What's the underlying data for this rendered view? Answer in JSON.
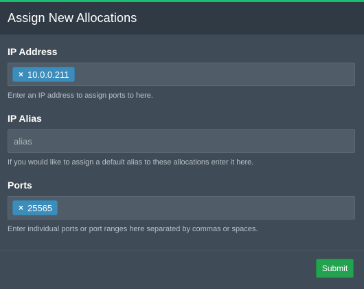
{
  "header": {
    "title": "Assign New Allocations"
  },
  "ip_address": {
    "label": "IP Address",
    "tag_remove": "×",
    "tag_value": "10.0.0.211",
    "help": "Enter an IP address to assign ports to here."
  },
  "ip_alias": {
    "label": "IP Alias",
    "placeholder": "alias",
    "value": "",
    "help": "If you would like to assign a default alias to these allocations enter it here."
  },
  "ports": {
    "label": "Ports",
    "tag_remove": "×",
    "tag_value": "25565",
    "help": "Enter individual ports or port ranges here separated by commas or spaces."
  },
  "footer": {
    "submit_label": "Submit"
  },
  "colors": {
    "accent_top_border": "#1bbd70",
    "tag_background": "#3c8dbc",
    "submit_background": "#23a24f"
  }
}
